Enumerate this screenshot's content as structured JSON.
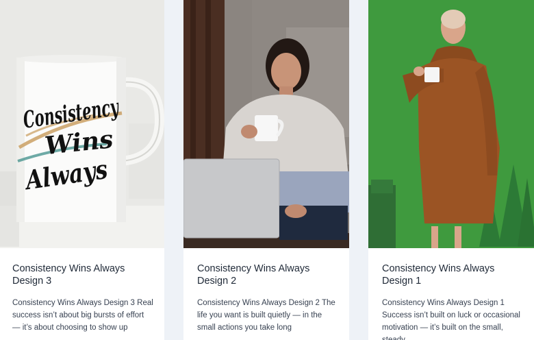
{
  "cards": [
    {
      "title": "Consistency Wins Always Design 3",
      "excerpt": "Consistency Wins Always Design 3 Real success isn’t about big bursts of effort — it’s about choosing to show up",
      "mug_text": [
        "Consistency",
        "Wins",
        "Always"
      ]
    },
    {
      "title": "Consistency Wins Always Design 2",
      "excerpt": "Consistency Wins Always Design 2 The life you want is built quietly — in the small actions you take long"
    },
    {
      "title": "Consistency Wins Always Design 1",
      "excerpt": "Consistency Wins Always Design 1 Success isn’t built on luck or occasional motivation — it’s built on the small, steady"
    }
  ]
}
